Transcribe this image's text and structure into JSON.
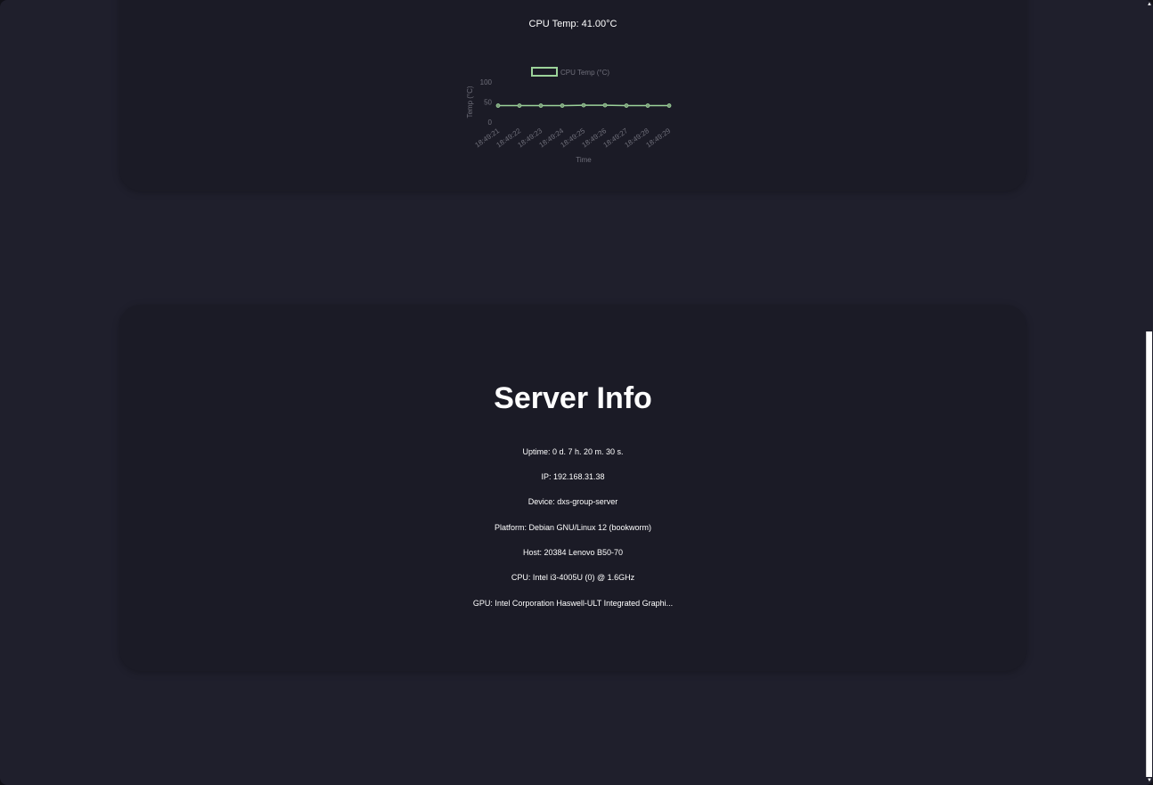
{
  "cpu_temp": {
    "label": "CPU Temp: 41.00°C"
  },
  "chart_data": {
    "type": "line",
    "title": "",
    "legend": "CPU Temp (°C)",
    "legend_position": "top",
    "xlabel": "Time",
    "ylabel": "Temp (°C)",
    "ylim": [
      0,
      100
    ],
    "yticks": [
      0,
      50,
      100
    ],
    "grid": false,
    "categories": [
      "18:49:21",
      "18:49:22",
      "18:49:23",
      "18:49:24",
      "18:49:25",
      "18:49:26",
      "18:49:27",
      "18:49:28",
      "18:49:29"
    ],
    "series": [
      {
        "name": "CPU Temp (°C)",
        "values": [
          41,
          41,
          41,
          41,
          42,
          42,
          41,
          41,
          41
        ],
        "color": "#9cd39a"
      }
    ]
  },
  "server_info": {
    "title": "Server Info",
    "uptime": "Uptime: 0 d. 7 h. 20 m. 30 s.",
    "ip": "IP: 192.168.31.38",
    "device": "Device: dxs-group-server",
    "platform": "Platform: Debian GNU/Linux 12 (bookworm)",
    "host": "Host: 20384 Lenovo B50-70",
    "cpu": "CPU: Intel i3-4005U (0) @ 1.6GHz",
    "gpu": "GPU: Intel Corporation Haswell-ULT Integrated Graphi..."
  },
  "scrollbar": {
    "up_icon": "triangle-up-icon",
    "down_icon": "triangle-down-icon"
  }
}
